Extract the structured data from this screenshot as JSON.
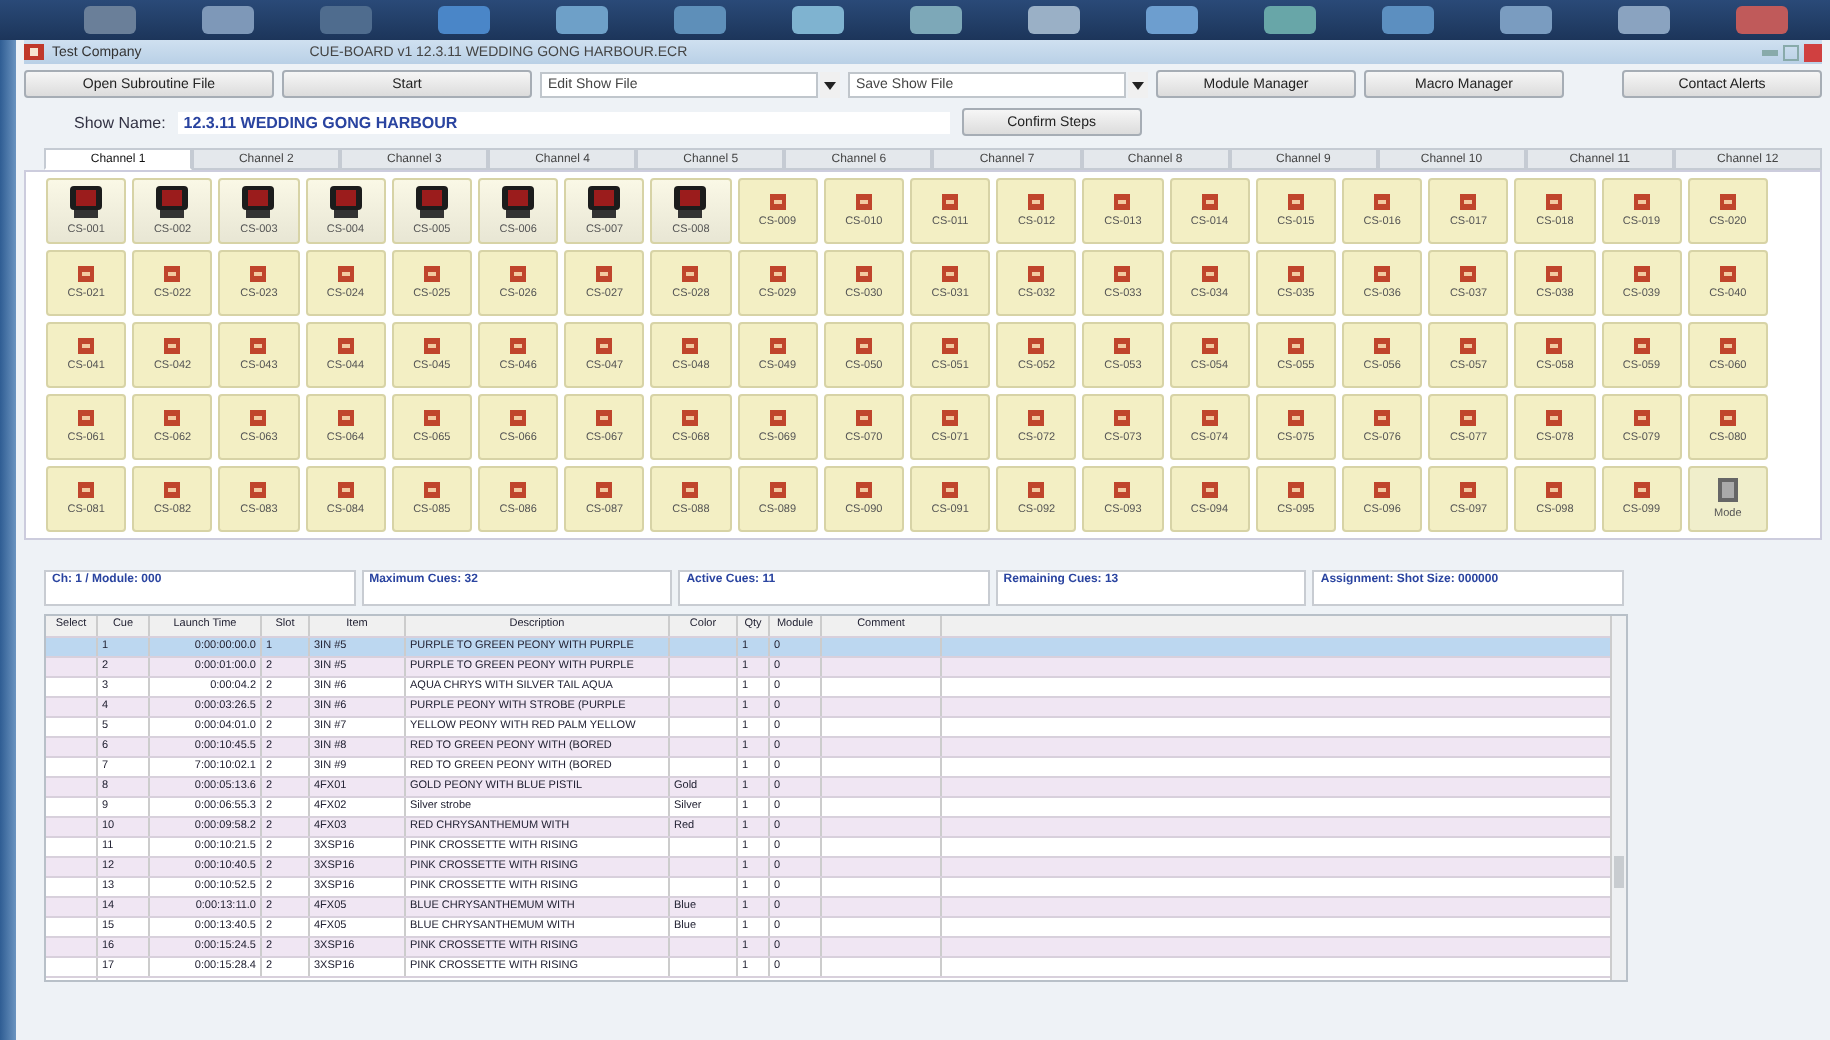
{
  "window": {
    "company": "Test Company",
    "title": "CUE-BOARD v1 12.3.11 WEDDING GONG HARBOUR.ECR"
  },
  "toolbar": {
    "open_button": "Open Subroutine File",
    "start_button": "Start",
    "edit_field": {
      "placeholder": "Edit Show File"
    },
    "save_field": {
      "placeholder": "Save Show File"
    },
    "module_button": "Module Manager",
    "macro_button": "Macro Manager",
    "contact_button": "Contact Alerts"
  },
  "show": {
    "label": "Show Name:",
    "name": "12.3.11 WEDDING GONG HARBOUR",
    "confirm_button": "Confirm Steps"
  },
  "tabs": [
    {
      "label": "Channel 1",
      "selected": true
    },
    {
      "label": "Channel 2",
      "selected": false
    },
    {
      "label": "Channel 3",
      "selected": false
    },
    {
      "label": "Channel 4",
      "selected": false
    },
    {
      "label": "Channel 5",
      "selected": false
    },
    {
      "label": "Channel 6",
      "selected": false
    },
    {
      "label": "Channel 7",
      "selected": false
    },
    {
      "label": "Channel 8",
      "selected": false
    },
    {
      "label": "Channel 9",
      "selected": false
    },
    {
      "label": "Channel 10",
      "selected": false
    },
    {
      "label": "Channel 11",
      "selected": false
    },
    {
      "label": "Channel 12",
      "selected": false
    }
  ],
  "cues": [
    {
      "kind": "module",
      "label": "CS-001"
    },
    {
      "kind": "module",
      "label": "CS-002"
    },
    {
      "kind": "module",
      "label": "CS-003"
    },
    {
      "kind": "module",
      "label": "CS-004"
    },
    {
      "kind": "module",
      "label": "CS-005"
    },
    {
      "kind": "module",
      "label": "CS-006"
    },
    {
      "kind": "module",
      "label": "CS-007"
    },
    {
      "kind": "module",
      "label": "CS-008"
    },
    {
      "kind": "empty",
      "label": "CS-009"
    },
    {
      "kind": "empty",
      "label": "CS-010"
    },
    {
      "kind": "empty",
      "label": "CS-011"
    },
    {
      "kind": "empty",
      "label": "CS-012"
    },
    {
      "kind": "empty",
      "label": "CS-013"
    },
    {
      "kind": "empty",
      "label": "CS-014"
    },
    {
      "kind": "empty",
      "label": "CS-015"
    },
    {
      "kind": "empty",
      "label": "CS-016"
    },
    {
      "kind": "empty",
      "label": "CS-017"
    },
    {
      "kind": "empty",
      "label": "CS-018"
    },
    {
      "kind": "empty",
      "label": "CS-019"
    },
    {
      "kind": "empty",
      "label": "CS-020"
    },
    {
      "kind": "empty",
      "label": "CS-021"
    },
    {
      "kind": "empty",
      "label": "CS-022"
    },
    {
      "kind": "empty",
      "label": "CS-023"
    },
    {
      "kind": "empty",
      "label": "CS-024"
    },
    {
      "kind": "empty",
      "label": "CS-025"
    },
    {
      "kind": "empty",
      "label": "CS-026"
    },
    {
      "kind": "empty",
      "label": "CS-027"
    },
    {
      "kind": "empty",
      "label": "CS-028"
    },
    {
      "kind": "empty",
      "label": "CS-029"
    },
    {
      "kind": "empty",
      "label": "CS-030"
    },
    {
      "kind": "empty",
      "label": "CS-031"
    },
    {
      "kind": "empty",
      "label": "CS-032"
    },
    {
      "kind": "empty",
      "label": "CS-033"
    },
    {
      "kind": "empty",
      "label": "CS-034"
    },
    {
      "kind": "empty",
      "label": "CS-035"
    },
    {
      "kind": "empty",
      "label": "CS-036"
    },
    {
      "kind": "empty",
      "label": "CS-037"
    },
    {
      "kind": "empty",
      "label": "CS-038"
    },
    {
      "kind": "empty",
      "label": "CS-039"
    },
    {
      "kind": "empty",
      "label": "CS-040"
    },
    {
      "kind": "empty",
      "label": "CS-041"
    },
    {
      "kind": "empty",
      "label": "CS-042"
    },
    {
      "kind": "empty",
      "label": "CS-043"
    },
    {
      "kind": "empty",
      "label": "CS-044"
    },
    {
      "kind": "empty",
      "label": "CS-045"
    },
    {
      "kind": "empty",
      "label": "CS-046"
    },
    {
      "kind": "empty",
      "label": "CS-047"
    },
    {
      "kind": "empty",
      "label": "CS-048"
    },
    {
      "kind": "empty",
      "label": "CS-049"
    },
    {
      "kind": "empty",
      "label": "CS-050"
    },
    {
      "kind": "empty",
      "label": "CS-051"
    },
    {
      "kind": "empty",
      "label": "CS-052"
    },
    {
      "kind": "empty",
      "label": "CS-053"
    },
    {
      "kind": "empty",
      "label": "CS-054"
    },
    {
      "kind": "empty",
      "label": "CS-055"
    },
    {
      "kind": "empty",
      "label": "CS-056"
    },
    {
      "kind": "empty",
      "label": "CS-057"
    },
    {
      "kind": "empty",
      "label": "CS-058"
    },
    {
      "kind": "empty",
      "label": "CS-059"
    },
    {
      "kind": "empty",
      "label": "CS-060"
    },
    {
      "kind": "empty",
      "label": "CS-061"
    },
    {
      "kind": "empty",
      "label": "CS-062"
    },
    {
      "kind": "empty",
      "label": "CS-063"
    },
    {
      "kind": "empty",
      "label": "CS-064"
    },
    {
      "kind": "empty",
      "label": "CS-065"
    },
    {
      "kind": "empty",
      "label": "CS-066"
    },
    {
      "kind": "empty",
      "label": "CS-067"
    },
    {
      "kind": "empty",
      "label": "CS-068"
    },
    {
      "kind": "empty",
      "label": "CS-069"
    },
    {
      "kind": "empty",
      "label": "CS-070"
    },
    {
      "kind": "empty",
      "label": "CS-071"
    },
    {
      "kind": "empty",
      "label": "CS-072"
    },
    {
      "kind": "empty",
      "label": "CS-073"
    },
    {
      "kind": "empty",
      "label": "CS-074"
    },
    {
      "kind": "empty",
      "label": "CS-075"
    },
    {
      "kind": "empty",
      "label": "CS-076"
    },
    {
      "kind": "empty",
      "label": "CS-077"
    },
    {
      "kind": "empty",
      "label": "CS-078"
    },
    {
      "kind": "empty",
      "label": "CS-079"
    },
    {
      "kind": "empty",
      "label": "CS-080"
    },
    {
      "kind": "empty",
      "label": "CS-081"
    },
    {
      "kind": "empty",
      "label": "CS-082"
    },
    {
      "kind": "empty",
      "label": "CS-083"
    },
    {
      "kind": "empty",
      "label": "CS-084"
    },
    {
      "kind": "empty",
      "label": "CS-085"
    },
    {
      "kind": "empty",
      "label": "CS-086"
    },
    {
      "kind": "empty",
      "label": "CS-087"
    },
    {
      "kind": "empty",
      "label": "CS-088"
    },
    {
      "kind": "empty",
      "label": "CS-089"
    },
    {
      "kind": "empty",
      "label": "CS-090"
    },
    {
      "kind": "empty",
      "label": "CS-091"
    },
    {
      "kind": "empty",
      "label": "CS-092"
    },
    {
      "kind": "empty",
      "label": "CS-093"
    },
    {
      "kind": "empty",
      "label": "CS-094"
    },
    {
      "kind": "empty",
      "label": "CS-095"
    },
    {
      "kind": "empty",
      "label": "CS-096"
    },
    {
      "kind": "empty",
      "label": "CS-097"
    },
    {
      "kind": "empty",
      "label": "CS-098"
    },
    {
      "kind": "empty",
      "label": "CS-099"
    },
    {
      "kind": "mode",
      "label": "Mode"
    }
  ],
  "info": [
    "Ch: 1 / Module: 000",
    "Maximum Cues: 32",
    "Active Cues: 11",
    "Remaining Cues: 13",
    "Assignment: Shot Size: 000000"
  ],
  "table": {
    "columns": [
      "Select",
      "Cue",
      "Launch Time",
      "Slot",
      "Item",
      "Description",
      "Color",
      "Qty",
      "Module",
      "Comment"
    ],
    "rows": [
      {
        "selected": true,
        "cells": [
          "",
          "1",
          "0:00:00:00.0",
          "1",
          "3IN #5",
          "PURPLE TO GREEN PEONY WITH PURPLE",
          "",
          "1",
          "0",
          ""
        ]
      },
      {
        "selected": false,
        "cells": [
          "",
          "2",
          "0:00:01:00.0",
          "2",
          "3IN #5",
          "PURPLE TO GREEN PEONY WITH PURPLE",
          "",
          "1",
          "0",
          ""
        ]
      },
      {
        "selected": false,
        "cells": [
          "",
          "3",
          "0:00:04.2",
          "2",
          "3IN #6",
          "AQUA CHRYS WITH SILVER TAIL AQUA",
          "",
          "1",
          "0",
          ""
        ]
      },
      {
        "selected": false,
        "cells": [
          "",
          "4",
          "0:00:03:26.5",
          "2",
          "3IN #6",
          "PURPLE PEONY WITH STROBE (PURPLE",
          "",
          "1",
          "0",
          ""
        ]
      },
      {
        "selected": false,
        "cells": [
          "",
          "5",
          "0:00:04:01.0",
          "2",
          "3IN #7",
          "YELLOW PEONY WITH RED PALM YELLOW",
          "",
          "1",
          "0",
          ""
        ]
      },
      {
        "selected": false,
        "cells": [
          "",
          "6",
          "0:00:10:45.5",
          "2",
          "3IN #8",
          "RED TO GREEN PEONY WITH (BORED",
          "",
          "1",
          "0",
          ""
        ]
      },
      {
        "selected": false,
        "cells": [
          "",
          "7",
          "7:00:10:02.1",
          "2",
          "3IN #9",
          "RED TO GREEN PEONY WITH (BORED",
          "",
          "1",
          "0",
          ""
        ]
      },
      {
        "selected": false,
        "cells": [
          "",
          "8",
          "0:00:05:13.6",
          "2",
          "4FX01",
          "GOLD PEONY WITH BLUE PISTIL",
          "Gold",
          "1",
          "0",
          ""
        ]
      },
      {
        "selected": false,
        "cells": [
          "",
          "9",
          "0:00:06:55.3",
          "2",
          "4FX02",
          "Silver strobe",
          "Silver",
          "1",
          "0",
          ""
        ]
      },
      {
        "selected": false,
        "cells": [
          "",
          "10",
          "0:00:09:58.2",
          "2",
          "4FX03",
          "RED CHRYSANTHEMUM WITH",
          "Red",
          "1",
          "0",
          ""
        ]
      },
      {
        "selected": false,
        "cells": [
          "",
          "11",
          "0:00:10:21.5",
          "2",
          "3XSP16",
          "PINK CROSSETTE WITH RISING",
          "",
          "1",
          "0",
          ""
        ]
      },
      {
        "selected": false,
        "cells": [
          "",
          "12",
          "0:00:10:40.5",
          "2",
          "3XSP16",
          "PINK CROSSETTE WITH RISING",
          "",
          "1",
          "0",
          ""
        ]
      },
      {
        "selected": false,
        "cells": [
          "",
          "13",
          "0:00:10:52.5",
          "2",
          "3XSP16",
          "PINK CROSSETTE WITH RISING",
          "",
          "1",
          "0",
          ""
        ]
      },
      {
        "selected": false,
        "cells": [
          "",
          "14",
          "0:00:13:11.0",
          "2",
          "4FX05",
          "BLUE CHRYSANTHEMUM WITH",
          "Blue",
          "1",
          "0",
          ""
        ]
      },
      {
        "selected": false,
        "cells": [
          "",
          "15",
          "0:00:13:40.5",
          "2",
          "4FX05",
          "BLUE CHRYSANTHEMUM WITH",
          "Blue",
          "1",
          "0",
          ""
        ]
      },
      {
        "selected": false,
        "cells": [
          "",
          "16",
          "0:00:15:24.5",
          "2",
          "3XSP16",
          "PINK CROSSETTE WITH RISING",
          "",
          "1",
          "0",
          ""
        ]
      },
      {
        "selected": false,
        "cells": [
          "",
          "17",
          "0:00:15:28.4",
          "2",
          "3XSP16",
          "PINK CROSSETTE WITH RISING",
          "",
          "1",
          "0",
          ""
        ]
      }
    ]
  }
}
